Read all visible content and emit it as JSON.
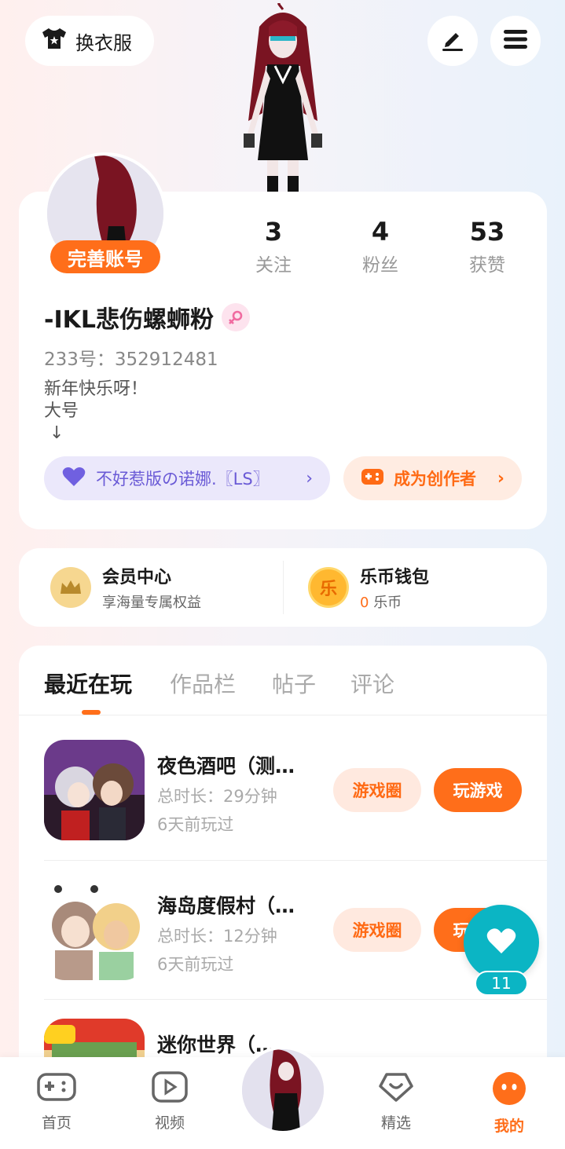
{
  "header": {
    "outfit_label": "换衣服",
    "edit_icon": "pen-icon",
    "menu_icon": "hamburger-menu-icon"
  },
  "profile": {
    "complete_label": "完善账号",
    "stats": [
      {
        "value": "3",
        "label": "关注"
      },
      {
        "value": "4",
        "label": "粉丝"
      },
      {
        "value": "53",
        "label": "获赞"
      }
    ],
    "username": "-IKL悲伤螺蛳粉",
    "gender": "female",
    "uid": "233号：352912481",
    "bio": "新年快乐呀！\n大号\n ↓",
    "guild_label": "不好惹版の诺娜.〖LS〗",
    "creator_label": "成为创作者"
  },
  "wallet": {
    "vip_title": "会员中心",
    "vip_sub": "享海量专属权益",
    "coin_title": "乐币钱包",
    "coin_amount": "0",
    "coin_unit": "乐币",
    "coin_glyph": "乐"
  },
  "tabs": [
    "最近在玩",
    "作品栏",
    "帖子",
    "评论"
  ],
  "games": [
    {
      "name": "夜色酒吧（测…",
      "time": "总时长：29分钟",
      "ago": "6天前玩过",
      "circle": "游戏圈",
      "play": "玩游戏"
    },
    {
      "name": "海岛度假村（…",
      "time": "总时长：12分钟",
      "ago": "6天前玩过",
      "circle": "游戏圈",
      "play": "玩游戏"
    },
    {
      "name": "迷你世界（…",
      "time": "",
      "ago": "",
      "circle": "",
      "play": ""
    }
  ],
  "float_like": {
    "count": "11"
  },
  "nav": [
    {
      "label": "首页",
      "icon": "gamepad-icon"
    },
    {
      "label": "视频",
      "icon": "video-play-icon"
    },
    {
      "label": "",
      "icon": "avatar"
    },
    {
      "label": "精选",
      "icon": "heart-badge-icon"
    },
    {
      "label": "我的",
      "icon": "profile-face-icon"
    }
  ],
  "colors": {
    "accent": "#ff6e1a",
    "teal": "#0bb5c4",
    "guild": "#6a5ad6"
  }
}
